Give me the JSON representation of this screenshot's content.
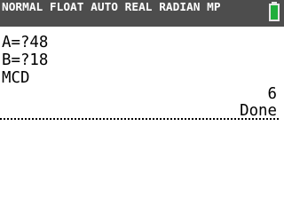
{
  "status_bar": {
    "mode_text": "NORMAL FLOAT AUTO REAL RADIAN MP",
    "battery_icon": "battery-full-icon",
    "battery_color": "#1fae3b",
    "background_color": "#4d4d4d"
  },
  "home_screen": {
    "lines": [
      {
        "text": "A=?48"
      },
      {
        "text": "B=?18"
      },
      {
        "text": "MCD"
      }
    ],
    "result": "6",
    "done": "Done"
  }
}
